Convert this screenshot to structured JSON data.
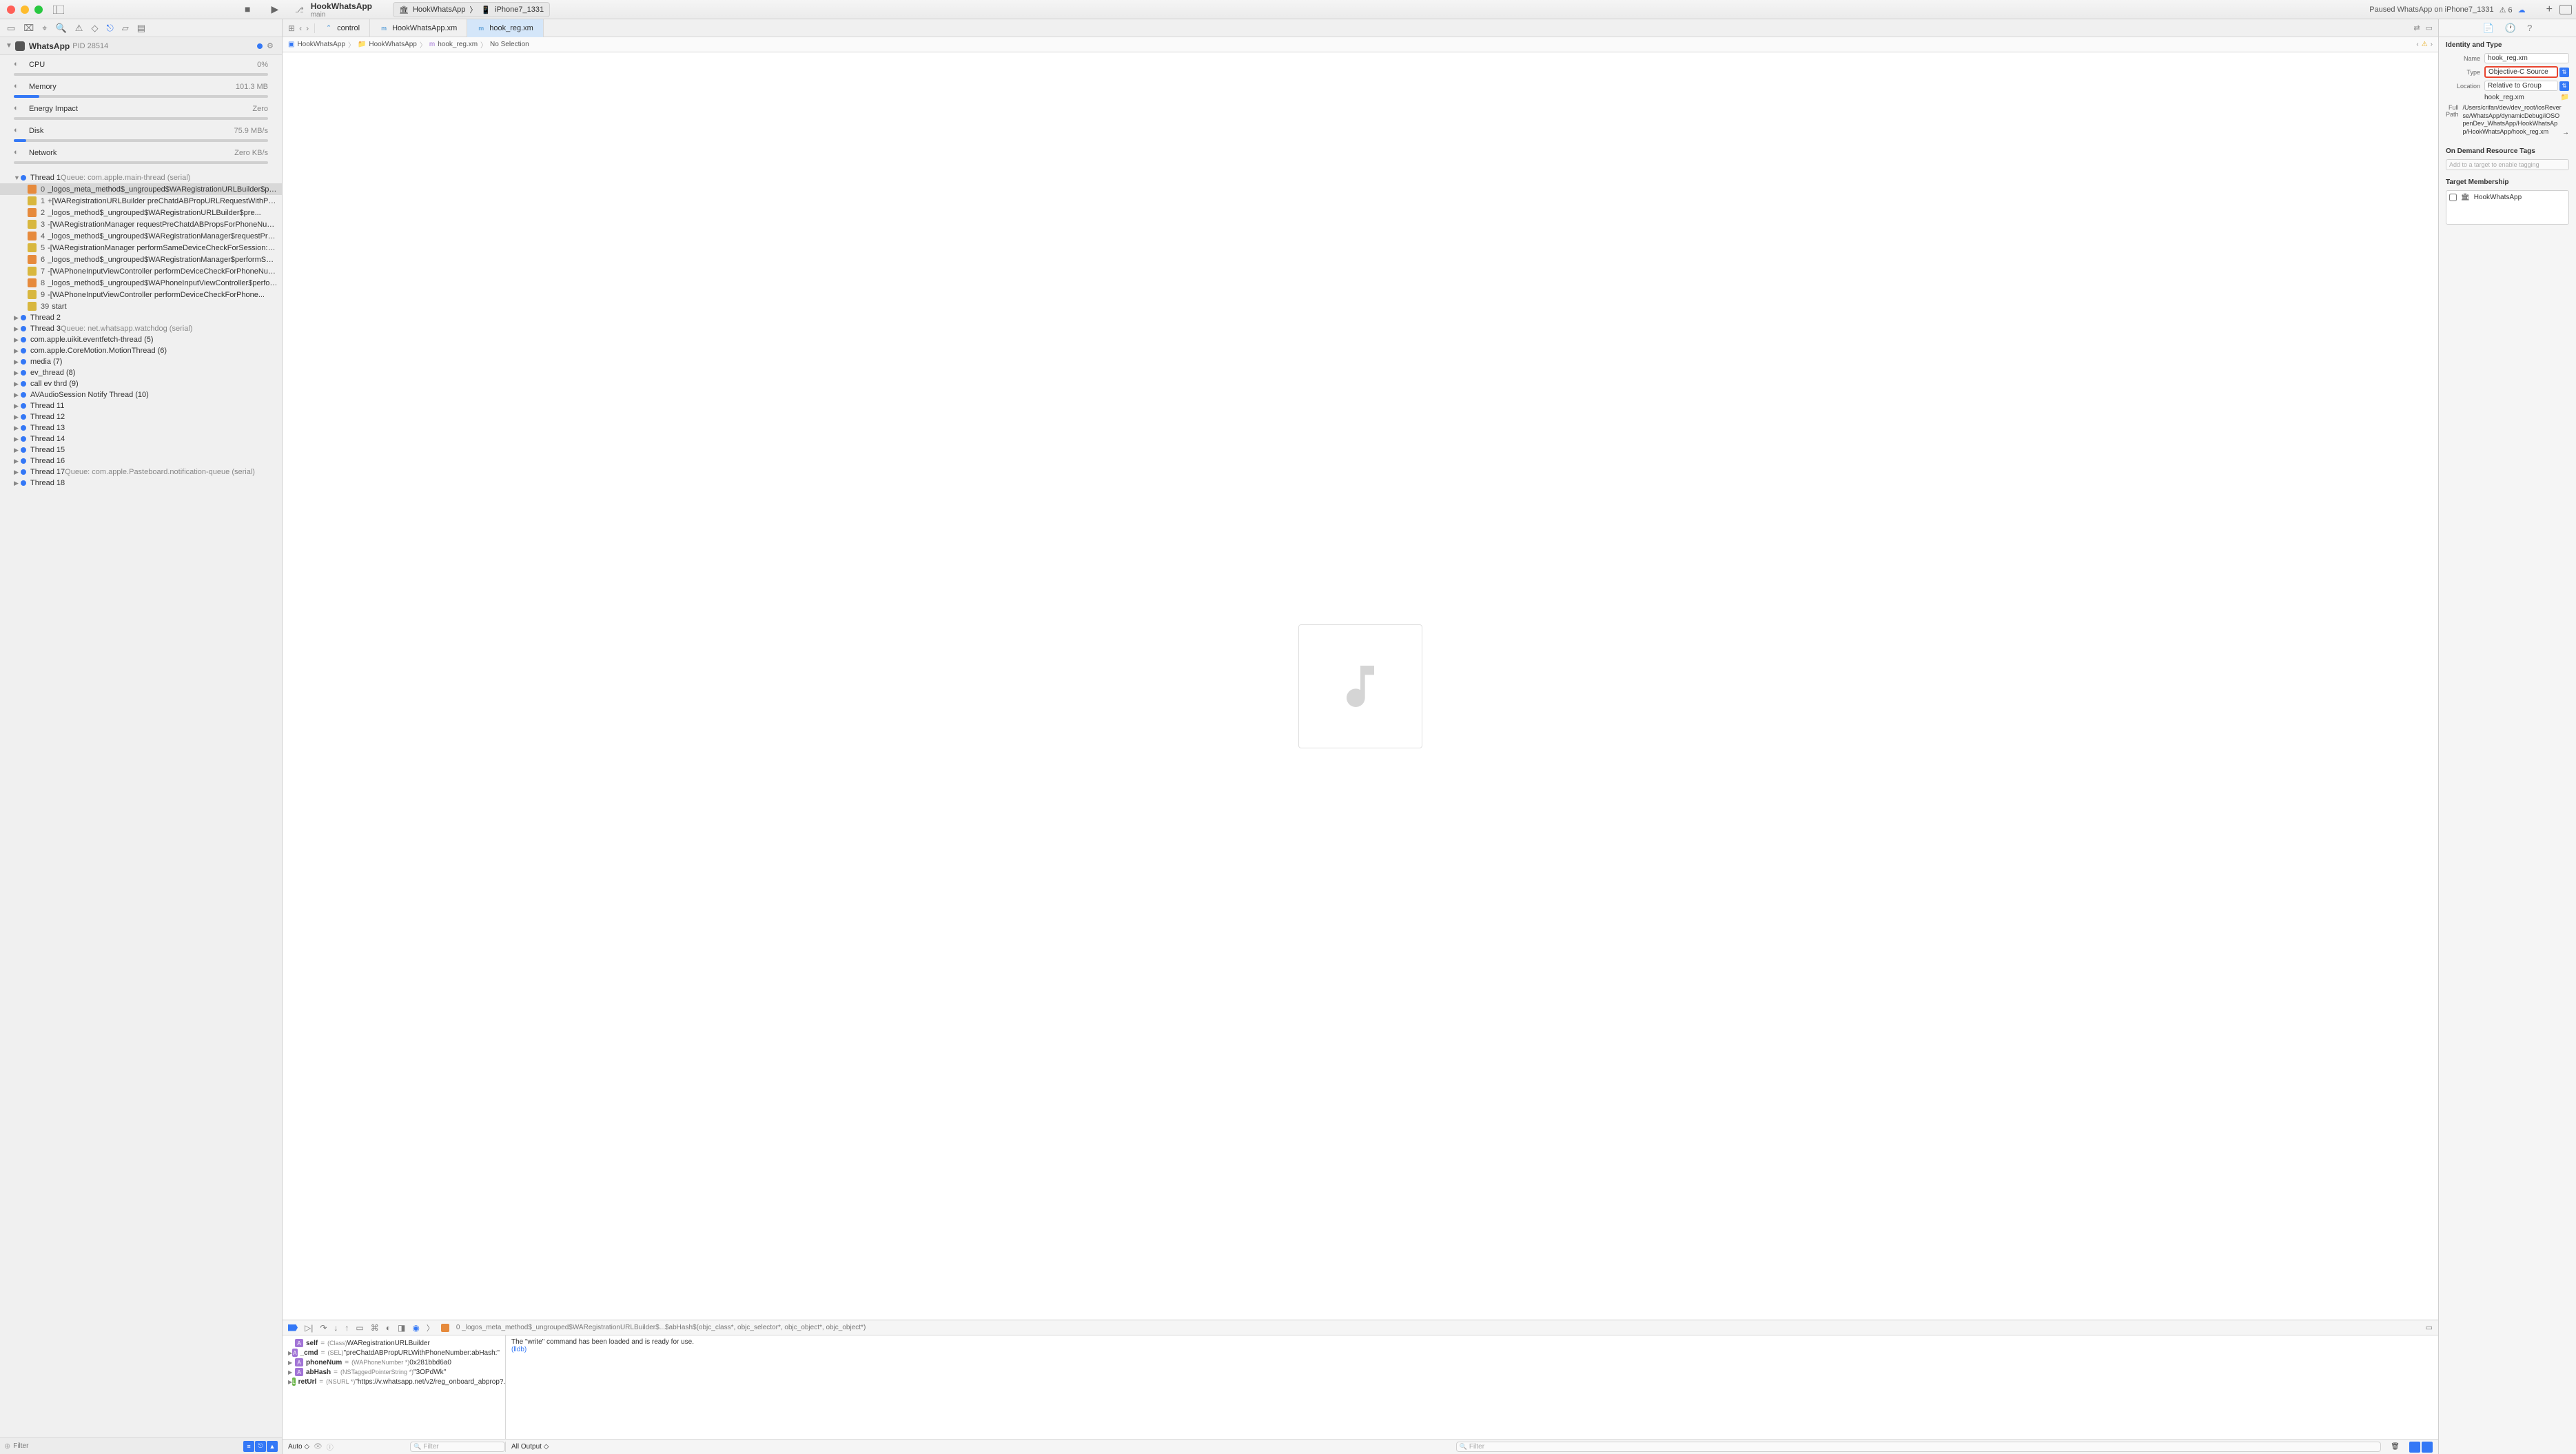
{
  "scheme": {
    "project": "HookWhatsApp",
    "branch": "main",
    "target": "HookWhatsApp",
    "device": "iPhone7_1331",
    "status": "Paused WhatsApp on iPhone7_1331",
    "warnings": "6"
  },
  "tabs": [
    {
      "label": "control",
      "icon": "⌃"
    },
    {
      "label": "HookWhatsApp.xm",
      "icon": "m"
    },
    {
      "label": "hook_reg.xm",
      "icon": "m",
      "active": true
    }
  ],
  "jumpbar": {
    "items": [
      "HookWhatsApp",
      "HookWhatsApp",
      "hook_reg.xm",
      "No Selection"
    ]
  },
  "navigator": {
    "app": "WhatsApp",
    "pid": "PID 28514",
    "gauges": [
      {
        "label": "CPU",
        "value": "0%",
        "fill": 0
      },
      {
        "label": "Memory",
        "value": "101.3 MB",
        "fill": 10
      },
      {
        "label": "Energy Impact",
        "value": "Zero",
        "fill": 0
      },
      {
        "label": "Disk",
        "value": "75.9 MB/s",
        "fill": 5
      },
      {
        "label": "Network",
        "value": "Zero KB/s",
        "fill": 0
      }
    ],
    "threads": [
      {
        "name": "Thread 1",
        "queue": "Queue: com.apple.main-thread (serial)",
        "expanded": true,
        "frames": [
          {
            "idx": "0",
            "text": "_logos_meta_method$_ungrouped$WARegistrationURLBuilder$pre...",
            "type": "orange",
            "selected": true
          },
          {
            "idx": "1",
            "text": "+[WARegistrationURLBuilder preChatdABPropURLRequestWithPhon...",
            "type": "yellow"
          },
          {
            "idx": "2",
            "text": "_logos_method$_ungrouped$WARegistrationURLBuilder$pre...",
            "type": "orange"
          },
          {
            "idx": "3",
            "text": "-[WARegistrationManager requestPreChatdABPropsForPhoneNumb...",
            "type": "yellow"
          },
          {
            "idx": "4",
            "text": "_logos_method$_ungrouped$WARegistrationManager$requestPreC...",
            "type": "orange"
          },
          {
            "idx": "5",
            "text": "-[WARegistrationManager performSameDeviceCheckForSession:up...",
            "type": "yellow"
          },
          {
            "idx": "6",
            "text": "_logos_method$_ungrouped$WARegistrationManager$performSam...",
            "type": "orange"
          },
          {
            "idx": "7",
            "text": "-[WAPhoneInputViewController performDeviceCheckForPhoneNumb...",
            "type": "yellow"
          },
          {
            "idx": "8",
            "text": "_logos_method$_ungrouped$WAPhoneInputViewController$perfor...",
            "type": "orange"
          },
          {
            "idx": "9",
            "text": "-[WAPhoneInputViewController performDeviceCheckForPhone...",
            "type": "yellow"
          },
          {
            "idx": "39",
            "text": "start",
            "type": "yellow"
          }
        ]
      },
      {
        "name": "Thread 2"
      },
      {
        "name": "Thread 3",
        "queue": "Queue: net.whatsapp.watchdog (serial)"
      },
      {
        "name": "com.apple.uikit.eventfetch-thread (5)"
      },
      {
        "name": "com.apple.CoreMotion.MotionThread (6)"
      },
      {
        "name": "media (7)"
      },
      {
        "name": "ev_thread (8)"
      },
      {
        "name": "call ev thrd (9)"
      },
      {
        "name": "AVAudioSession Notify Thread (10)"
      },
      {
        "name": "Thread 11"
      },
      {
        "name": "Thread 12"
      },
      {
        "name": "Thread 13"
      },
      {
        "name": "Thread 14"
      },
      {
        "name": "Thread 15"
      },
      {
        "name": "Thread 16"
      },
      {
        "name": "Thread 17",
        "queue": "Queue: com.apple.Pasteboard.notification-queue (serial)"
      },
      {
        "name": "Thread 18"
      }
    ],
    "filter_placeholder": "Filter"
  },
  "debug": {
    "frame": "0 _logos_meta_method$_ungrouped$WARegistrationURLBuilder$...$abHash$(objc_class*, objc_selector*, objc_object*, objc_object*)",
    "vars": [
      {
        "name": "self",
        "type": "(Class)",
        "value": "WARegistrationURLBuilder",
        "badge": "A"
      },
      {
        "name": "_cmd",
        "type": "(SEL)",
        "value": "\"preChatdABPropURLWithPhoneNumber:abHash:\"",
        "badge": "A",
        "chev": true
      },
      {
        "name": "phoneNum",
        "type": "(WAPhoneNumber *)",
        "value": "0x281bbd6a0",
        "badge": "A",
        "chev": true
      },
      {
        "name": "abHash",
        "type": "(NSTaggedPointerString *)",
        "value": "\"3OPdWk\"",
        "badge": "A",
        "chev": true
      },
      {
        "name": "retUrl",
        "type": "(NSURL *)",
        "value": "\"https://v.whatsapp.net/v2/reg_onboard_abprop?...",
        "badge": "L",
        "chev": true
      }
    ],
    "console": [
      {
        "text": "The \"write\" command has been loaded and is ready for use."
      },
      {
        "text": "(lldb) ",
        "prompt": true
      }
    ],
    "auto_label": "Auto ◇",
    "output_label": "All Output ◇",
    "filter_placeholder": "Filter"
  },
  "inspector": {
    "heading1": "Identity and Type",
    "name_label": "Name",
    "name_value": "hook_reg.xm",
    "type_label": "Type",
    "type_value": "Objective-C Source",
    "location_label": "Location",
    "location_value": "Relative to Group",
    "location_file": "hook_reg.xm",
    "fullpath_label": "Full Path",
    "fullpath_value": "/Users/crifan/dev/dev_root/iosReverse/WhatsApp/dynamicDebug/iOSOpenDev_WhatsApp/HookWhatsApp/HookWhatsApp/hook_reg.xm",
    "heading2": "On Demand Resource Tags",
    "tags_placeholder": "Add to a target to enable tagging",
    "heading3": "Target Membership",
    "target_name": "HookWhatsApp"
  }
}
